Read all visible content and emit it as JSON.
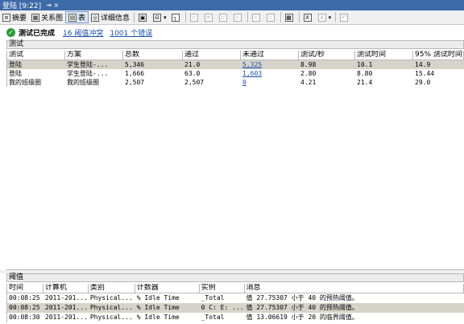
{
  "window": {
    "title": "登陆 [9:22]",
    "pin": "⇥ ×",
    "close": "✕"
  },
  "toolbar": {
    "summary": "摘要",
    "graph": "关系图",
    "table": "表",
    "details": "详细信息"
  },
  "status": {
    "text": "测试已完成",
    "threshold_link": "16 阈值冲突",
    "error_link": "1001 个错误"
  },
  "tests": {
    "section_title": "测试",
    "columns": [
      "测试",
      "方案",
      "总数",
      "通过",
      "未通过",
      "测试/秒",
      "测试时间",
      "95% 测试时间"
    ],
    "rows": [
      [
        "登陆",
        "学生登陆-...",
        "5,346",
        "21.0",
        "5,325",
        "8.98",
        "10.1",
        "14.9"
      ],
      [
        "登陆",
        "学生登陆-...",
        "1,666",
        "63.0",
        "1,603",
        "2.80",
        "8.80",
        "15.44"
      ],
      [
        "我的班级圈",
        "我的班级圈",
        "2,507",
        "2,507",
        "0",
        "4.21",
        "21.4",
        "29.0"
      ]
    ]
  },
  "thresholds": {
    "section_title": "阈值",
    "columns": [
      "时间",
      "计算机",
      "类别",
      "计数器",
      "实例",
      "消息"
    ],
    "rows": [
      [
        "00:08:25",
        "2011-201...",
        "Physical...",
        "% Idle Time",
        "_Total",
        "值 27.75307 小于 40 的预热阈值。"
      ],
      [
        "00:08:25",
        "2011-201...",
        "Physical...",
        "% Idle Time",
        "0 C: E: ...",
        "值 27.75307 小于 40 的预热阈值。"
      ],
      [
        "00:08:30",
        "2011-201...",
        "Physical...",
        "% Idle Time",
        "_Total",
        "值 13.06619 小于 20 的临界阈值。"
      ]
    ]
  }
}
